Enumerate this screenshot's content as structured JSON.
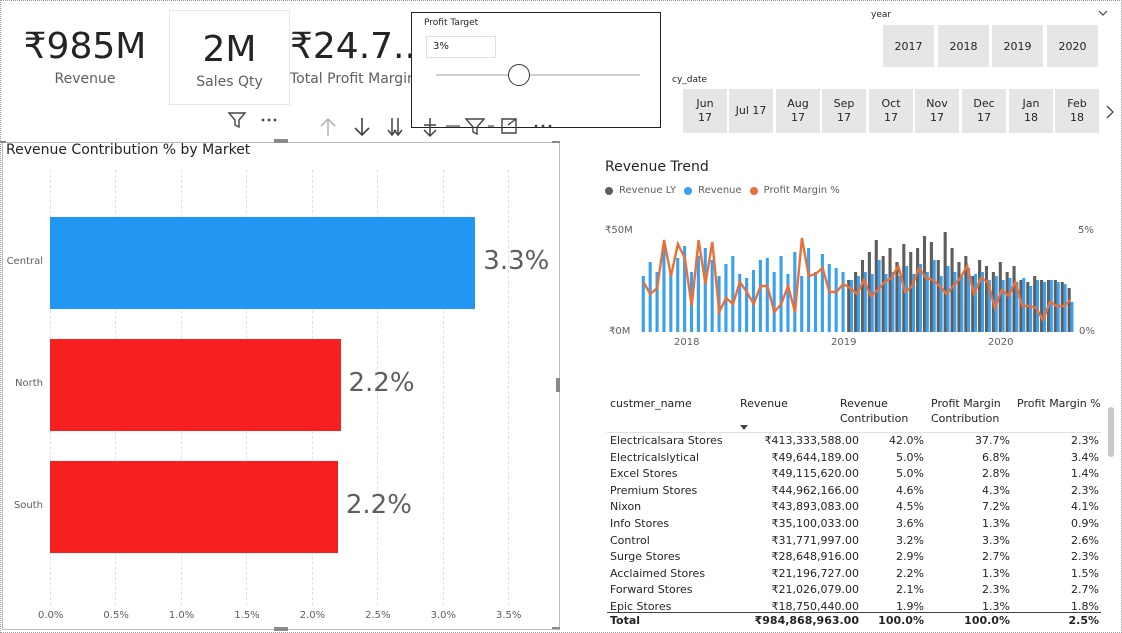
{
  "kpis": {
    "revenue": {
      "value": "₹985M",
      "label": "Revenue"
    },
    "sales_qty": {
      "value": "2M",
      "label": "Sales Qty"
    },
    "profit_margin": {
      "value": "₹24.7...",
      "label": "Total Profit Margin"
    }
  },
  "profit_target": {
    "title": "Profit Target",
    "value": "3%",
    "slider_fraction": 0.4
  },
  "year_slicer": {
    "title": "year",
    "years": [
      "2017",
      "2018",
      "2019",
      "2020"
    ]
  },
  "date_slicer": {
    "title": "cy_date",
    "months": [
      {
        "m": "Jun",
        "y": "17"
      },
      {
        "m": "Jul 17",
        "y": ""
      },
      {
        "m": "Aug",
        "y": "17"
      },
      {
        "m": "Sep",
        "y": "17"
      },
      {
        "m": "Oct",
        "y": "17"
      },
      {
        "m": "Nov",
        "y": "17"
      },
      {
        "m": "Dec",
        "y": "17"
      },
      {
        "m": "Jan",
        "y": "18"
      },
      {
        "m": "Feb",
        "y": "18"
      }
    ]
  },
  "bar_chart": {
    "title": "Revenue Contribution % by Market",
    "icons": [
      "filter-icon",
      "more-options-icon"
    ]
  },
  "trend_chart": {
    "title": "Revenue Trend",
    "legend": [
      "Revenue LY",
      "Revenue",
      "Profit Margin %"
    ],
    "left_axis": [
      "₹50M",
      "₹0M"
    ],
    "right_axis": [
      "5%",
      "0%"
    ],
    "x_labels": [
      "2018",
      "2019",
      "2020"
    ]
  },
  "table": {
    "headers": {
      "name": "custmer_name",
      "revenue": "Revenue",
      "rev_contrib_1": "Revenue",
      "rev_contrib_2": "Contribution",
      "pm_contrib_1": "Profit Margin",
      "pm_contrib_2": "Contribution",
      "pm_pct": "Profit Margin %"
    },
    "rows": [
      [
        "Electricalsara Stores",
        "₹413,333,588.00",
        "42.0%",
        "37.7%",
        "2.3%"
      ],
      [
        "Electricalslytical",
        "₹49,644,189.00",
        "5.0%",
        "6.8%",
        "3.4%"
      ],
      [
        "Excel Stores",
        "₹49,115,620.00",
        "5.0%",
        "2.8%",
        "1.4%"
      ],
      [
        "Premium Stores",
        "₹44,962,166.00",
        "4.6%",
        "4.3%",
        "2.3%"
      ],
      [
        "Nixon",
        "₹43,893,083.00",
        "4.5%",
        "7.2%",
        "4.1%"
      ],
      [
        "Info Stores",
        "₹35,100,033.00",
        "3.6%",
        "1.3%",
        "0.9%"
      ],
      [
        "Control",
        "₹31,771,997.00",
        "3.2%",
        "3.3%",
        "2.6%"
      ],
      [
        "Surge Stores",
        "₹28,648,916.00",
        "2.9%",
        "2.7%",
        "2.3%"
      ],
      [
        "Acclaimed Stores",
        "₹21,196,727.00",
        "2.2%",
        "1.3%",
        "1.5%"
      ],
      [
        "Forward Stores",
        "₹21,026,079.00",
        "2.1%",
        "2.3%",
        "2.7%"
      ],
      [
        "Epic Stores",
        "₹18,750,440.00",
        "1.9%",
        "1.3%",
        "1.8%"
      ]
    ],
    "total": [
      "Total",
      "₹984,868,963.00",
      "100.0%",
      "100.0%",
      "2.5%"
    ]
  },
  "chart_data": [
    {
      "type": "bar",
      "title": "Revenue Contribution % by Market",
      "orientation": "horizontal",
      "categories": [
        "Central",
        "North",
        "South"
      ],
      "values": [
        3.25,
        2.22,
        2.2
      ],
      "data_labels": [
        "3.3%",
        "2.2%",
        "2.2%"
      ],
      "colors": [
        "#2196f3",
        "#f5201f",
        "#f5201f"
      ],
      "x_ticks": [
        "0.0%",
        "0.5%",
        "1.0%",
        "1.5%",
        "2.0%",
        "2.5%",
        "3.0%",
        "3.5%"
      ],
      "xlim": [
        0,
        3.5
      ],
      "grid": true
    },
    {
      "type": "bar",
      "title": "Revenue Trend",
      "series": [
        {
          "name": "Revenue LY",
          "color": "#605e5c",
          "values": [
            0,
            0,
            0,
            0,
            0,
            0,
            0,
            0,
            0,
            0,
            0,
            0,
            0,
            0,
            0,
            0,
            0,
            0,
            0,
            0,
            0,
            0,
            0,
            0,
            0,
            0,
            0,
            0,
            0,
            0,
            26,
            30,
            36,
            40,
            46,
            38,
            42,
            35,
            44,
            40,
            42,
            48,
            45,
            36,
            50,
            42,
            35,
            38,
            28,
            36,
            33,
            30,
            35,
            30,
            33,
            26,
            25,
            28,
            26,
            26,
            26,
            25,
            22
          ]
        },
        {
          "name": "Revenue",
          "color": "#3aa0f0",
          "values": [
            28,
            35,
            30,
            43,
            30,
            37,
            43,
            30,
            38,
            42,
            36,
            28,
            34,
            38,
            29,
            27,
            31,
            36,
            37,
            30,
            38,
            29,
            40,
            28,
            42,
            30,
            39,
            34,
            32,
            30,
            26,
            28,
            30,
            29,
            36,
            29,
            30,
            28,
            33,
            29,
            34,
            30,
            36,
            28,
            33,
            30,
            28,
            32,
            29,
            30,
            26,
            28,
            26,
            27,
            25,
            27,
            23,
            26,
            25,
            26,
            25,
            24,
            15
          ]
        },
        {
          "name": "Profit Margin %",
          "color": "#e8703a",
          "values": [
            2.5,
            1.9,
            2.2,
            4.6,
            2.8,
            4.4,
            3.7,
            1.3,
            4.6,
            2.4,
            4.5,
            1.0,
            1.7,
            1.4,
            2.5,
            2.0,
            1.4,
            2.3,
            2.3,
            1.0,
            1.4,
            2.3,
            1.0,
            4.7,
            2.8,
            2.9,
            3.2,
            2.0,
            2.0,
            2.4,
            2.2,
            1.9,
            2.6,
            1.8,
            2.1,
            2.5,
            2.7,
            3.3,
            2.0,
            2.3,
            3.2,
            2.7,
            2.6,
            2.3,
            1.9,
            2.3,
            2.7,
            3.3,
            1.9,
            2.7,
            2.5,
            1.2,
            2.1,
            1.8,
            2.5,
            1.3,
            1.3,
            1.2,
            0.6,
            1.5,
            1.3,
            1.3,
            1.6
          ]
        }
      ],
      "x_labels": [
        "2018",
        "2019",
        "2020"
      ],
      "left_axis_range_millions": [
        0,
        50
      ],
      "right_axis_range_percent": [
        0,
        5
      ]
    }
  ]
}
